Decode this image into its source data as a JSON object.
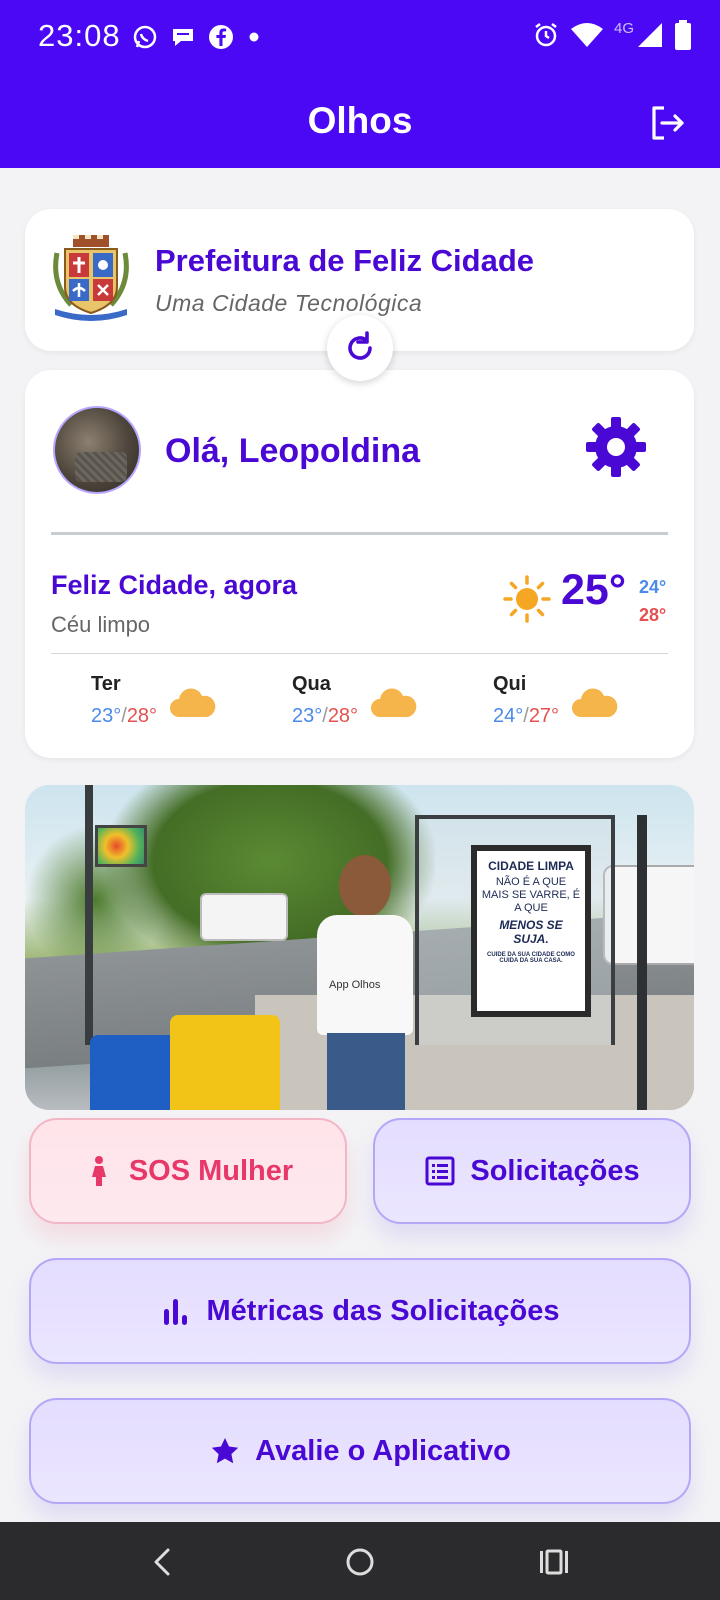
{
  "status_bar": {
    "time": "23:08",
    "network_label": "4G",
    "left_icons": [
      "whatsapp-icon",
      "chat-bubble-icon",
      "facebook-icon",
      "dot-icon"
    ],
    "right_icons": [
      "alarm-icon",
      "wifi-icon",
      "signal-icon",
      "battery-icon"
    ]
  },
  "app_bar": {
    "title": "Olhos",
    "logout_icon": "logout-icon"
  },
  "city_card": {
    "name": "Prefeitura de Feliz Cidade",
    "slogan": "Uma Cidade Tecnológica",
    "crest_icon": "city-crest-icon"
  },
  "user_card": {
    "greeting": "Olá, Leopoldina",
    "settings_icon": "gear-icon"
  },
  "weather": {
    "location": "Feliz Cidade, agora",
    "condition": "Céu limpo",
    "temperature": "25°",
    "min": "24°",
    "max": "28°",
    "forecast": [
      {
        "day": "Ter",
        "min": "23°",
        "max": "28°",
        "icon": "cloud-icon"
      },
      {
        "day": "Qua",
        "min": "23°",
        "max": "28°",
        "icon": "cloud-icon"
      },
      {
        "day": "Qui",
        "min": "24°",
        "max": "27°",
        "icon": "cloud-icon"
      }
    ]
  },
  "banner": {
    "shirt_text": "App Olhos",
    "poster": {
      "line1": "CIDADE LIMPA",
      "line2": "NÃO É A QUE MAIS SE VARRE, É A QUE",
      "line3": "MENOS SE SUJA.",
      "line4": "CUIDE DA SUA CIDADE COMO CUIDA DA SUA CASA."
    }
  },
  "actions": {
    "sos": "SOS Mulher",
    "requests": "Solicitações",
    "metrics": "Métricas das Solicitações",
    "rate": "Avalie o Aplicativo"
  },
  "nav": {
    "back": "back-icon",
    "home": "home-icon",
    "recents": "recents-icon"
  },
  "colors": {
    "primary": "#4a08f5",
    "sos": "#e8386a",
    "min_temp": "#4a8ae8",
    "max_temp": "#e55050"
  }
}
